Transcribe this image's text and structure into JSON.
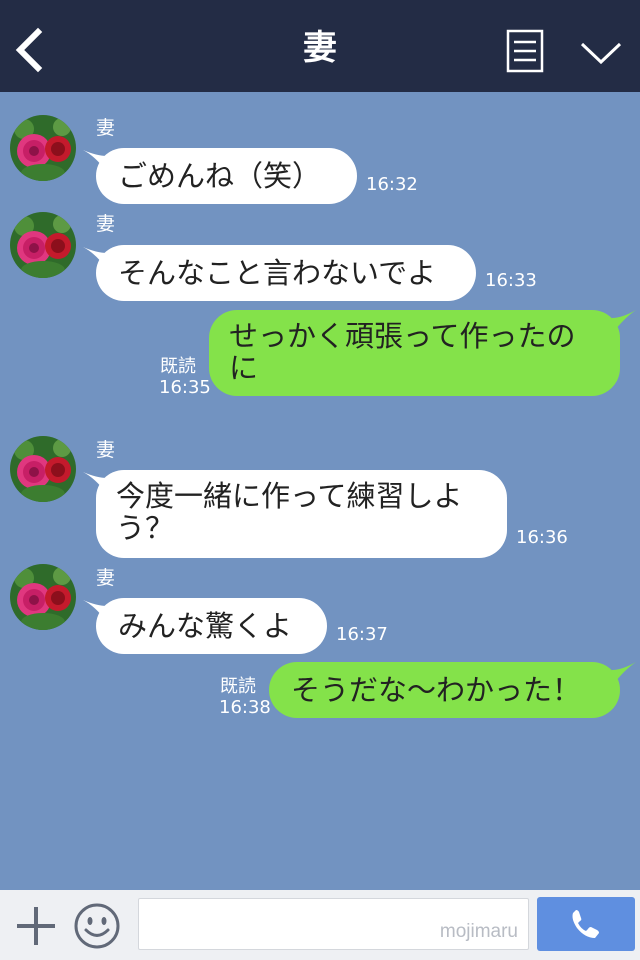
{
  "header": {
    "title": "妻",
    "back_icon": "chevron-left-icon",
    "notes_icon": "notes-icon",
    "menu_icon": "chevron-down-icon"
  },
  "messages": [
    {
      "direction": "in",
      "sender": "妻",
      "text": "ごめんね（笑）",
      "time": "16:32"
    },
    {
      "direction": "in",
      "sender": "妻",
      "text": "そんなこと言わないでよ",
      "time": "16:33"
    },
    {
      "direction": "out",
      "line1": "せっかく頑張って作ったの",
      "line2": "に",
      "read": "既読",
      "time": "16:35"
    },
    {
      "direction": "in",
      "sender": "妻",
      "line1": "今度一緒に作って練習しよ",
      "line2": "う？",
      "time": "16:36"
    },
    {
      "direction": "in",
      "sender": "妻",
      "text": "みんな驚くよ",
      "time": "16:37"
    },
    {
      "direction": "out",
      "text": "そうだな〜わかった！",
      "read": "既読",
      "time": "16:38"
    }
  ],
  "footer": {
    "input_value": "",
    "watermark": "mojimaru",
    "plus_icon": "plus-icon",
    "emoji_icon": "smiley-icon",
    "call_icon": "phone-icon"
  },
  "colors": {
    "header_bg": "#232c45",
    "chat_bg": "#7293c1",
    "incoming_bubble": "#ffffff",
    "outgoing_bubble": "#84e24a",
    "call_button": "#5f8fe0"
  }
}
